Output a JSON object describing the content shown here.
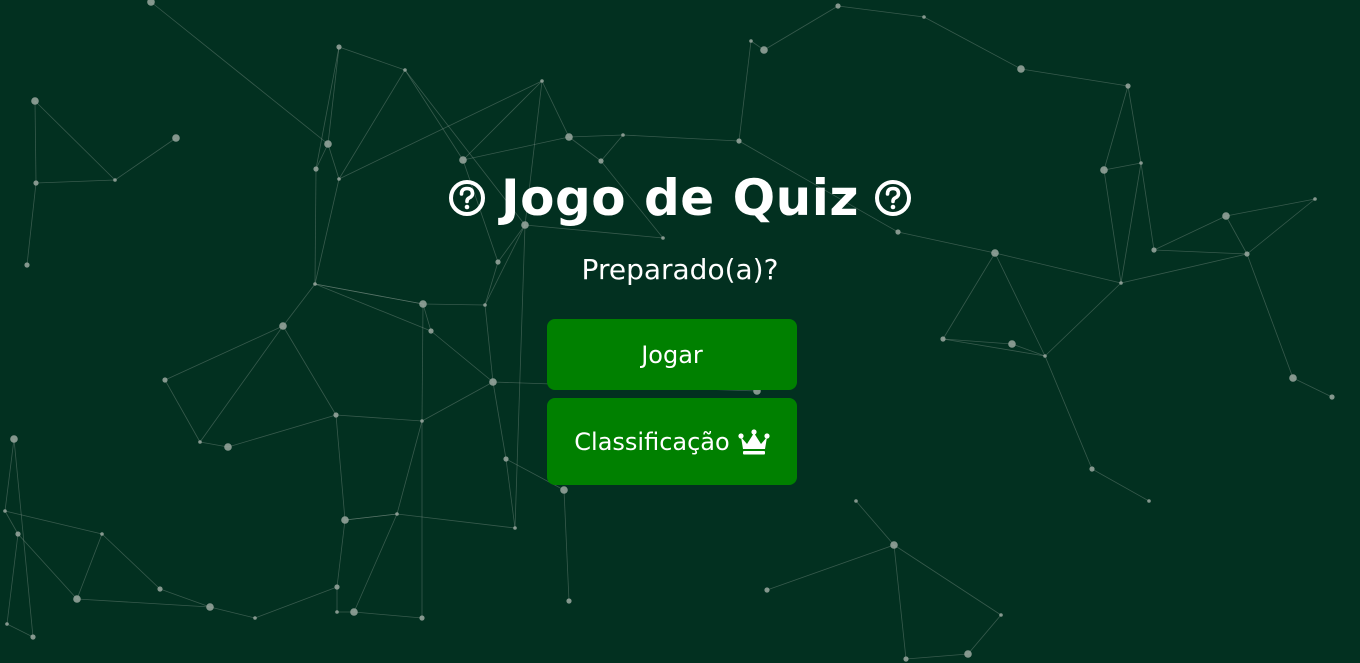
{
  "page": {
    "title": "Jogo de Quiz",
    "title_icon_left": "question-circle-icon",
    "title_icon_right": "question-circle-icon",
    "subtitle": "Preparado(a)?"
  },
  "buttons": {
    "play_label": "Jogar",
    "ranking_label": "Classificação",
    "ranking_icon": "crown-icon"
  },
  "colors": {
    "background": "#023020",
    "button": "#008000",
    "text": "#ffffff",
    "network": "#9aa8a0"
  }
}
